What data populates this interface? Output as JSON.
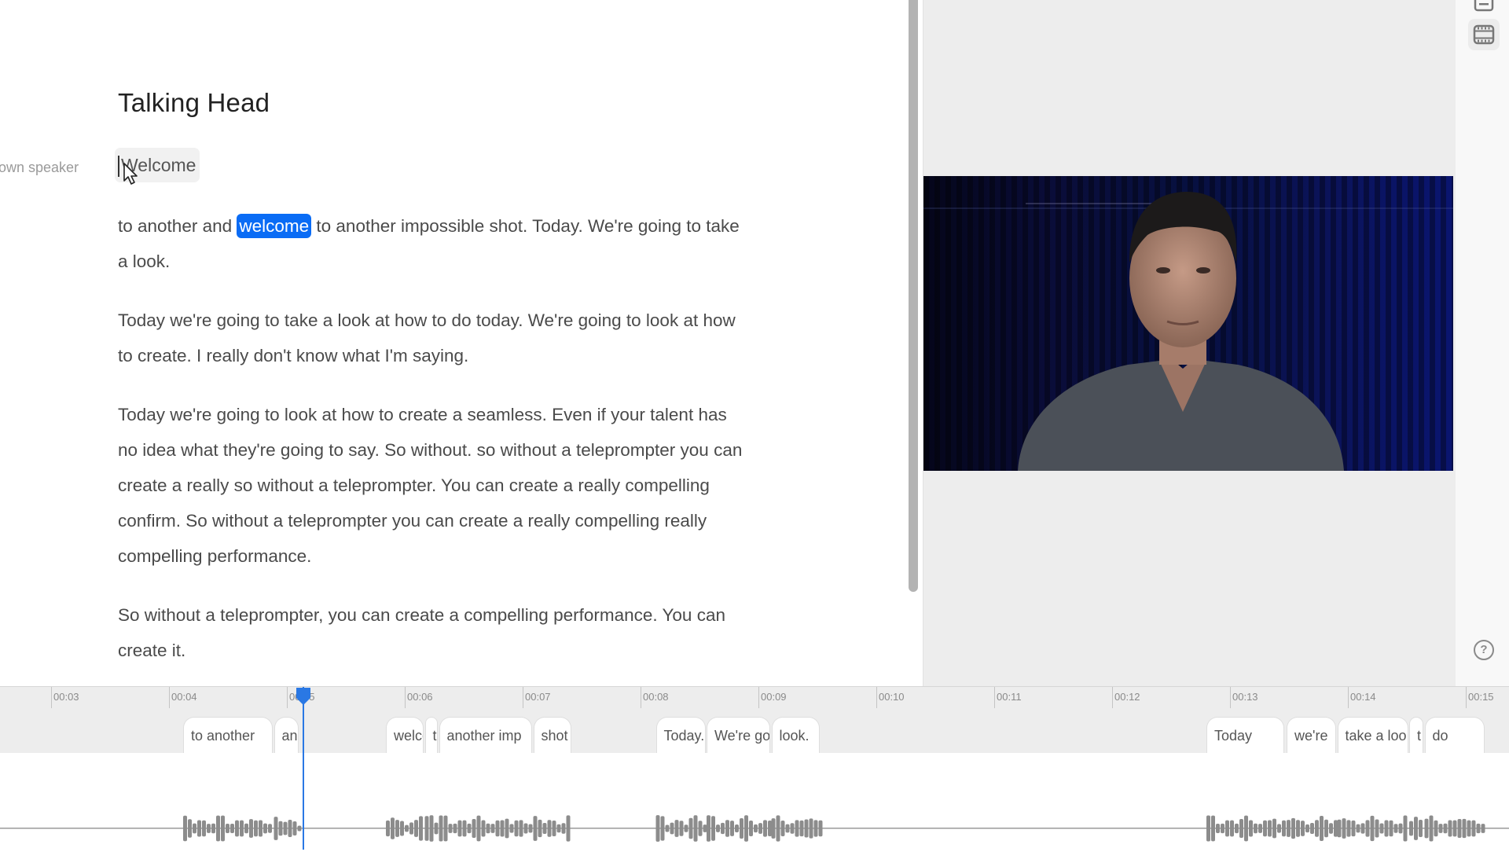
{
  "document": {
    "title": "Talking Head",
    "speaker_label": "own speaker",
    "first_word": "Welcome",
    "paragraphs": [
      {
        "before": "to another and ",
        "highlight": "welcome",
        "after": " to another impossible shot. Today. We're going to take a look."
      },
      {
        "text": "Today we're going to take a look at how to do today. We're going to look at how to create. I really don't know what I'm saying."
      },
      {
        "text": "Today we're going to look at how to create a seamless. Even if your talent has no idea what they're going to say. So without.  so without a teleprompter you can create a really so without a teleprompter. You can create a really compelling confirm. So without a teleprompter you can create a really compelling really compelling performance."
      },
      {
        "text": "So without a teleprompter, you can create a compelling performance. You can create it."
      }
    ]
  },
  "sidebar": {
    "icons": [
      {
        "name": "captions-icon"
      },
      {
        "name": "film-icon",
        "active": true
      }
    ],
    "help_label": "?"
  },
  "video": {
    "description": "Man speaking in front of dark blue acoustic foam wall"
  },
  "colors": {
    "accent": "#0a6cf5",
    "playhead": "#2a78e4"
  },
  "timeline": {
    "ticks": [
      "00:03",
      "00:04",
      "00:05",
      "00:06",
      "00:07",
      "00:08",
      "00:09",
      "00:10",
      "00:11",
      "00:12",
      "00:13",
      "00:14",
      "00:15"
    ],
    "playhead_time": "00:05.1",
    "words": [
      {
        "label": "to another",
        "start": 4.12,
        "end": 4.88
      },
      {
        "label": "an",
        "start": 4.89,
        "end": 5.1
      },
      {
        "label": "welco",
        "start": 5.84,
        "end": 6.16
      },
      {
        "label": "to",
        "start": 6.17,
        "end": 6.28
      },
      {
        "label": "another imp",
        "start": 6.29,
        "end": 7.08
      },
      {
        "label": "shot",
        "start": 7.09,
        "end": 7.41
      },
      {
        "label": "Today.",
        "start": 8.13,
        "end": 8.55
      },
      {
        "label": "We're go",
        "start": 8.56,
        "end": 9.1
      },
      {
        "label": "look.",
        "start": 9.11,
        "end": 9.52
      },
      {
        "label": "Today",
        "start": 12.8,
        "end": 13.46
      },
      {
        "label": "we're",
        "start": 13.48,
        "end": 13.9
      },
      {
        "label": "take a loo",
        "start": 13.91,
        "end": 14.51
      },
      {
        "label": "t",
        "start": 14.52,
        "end": 14.64
      },
      {
        "label": "do",
        "start": 14.65,
        "end": 15.16
      }
    ]
  }
}
